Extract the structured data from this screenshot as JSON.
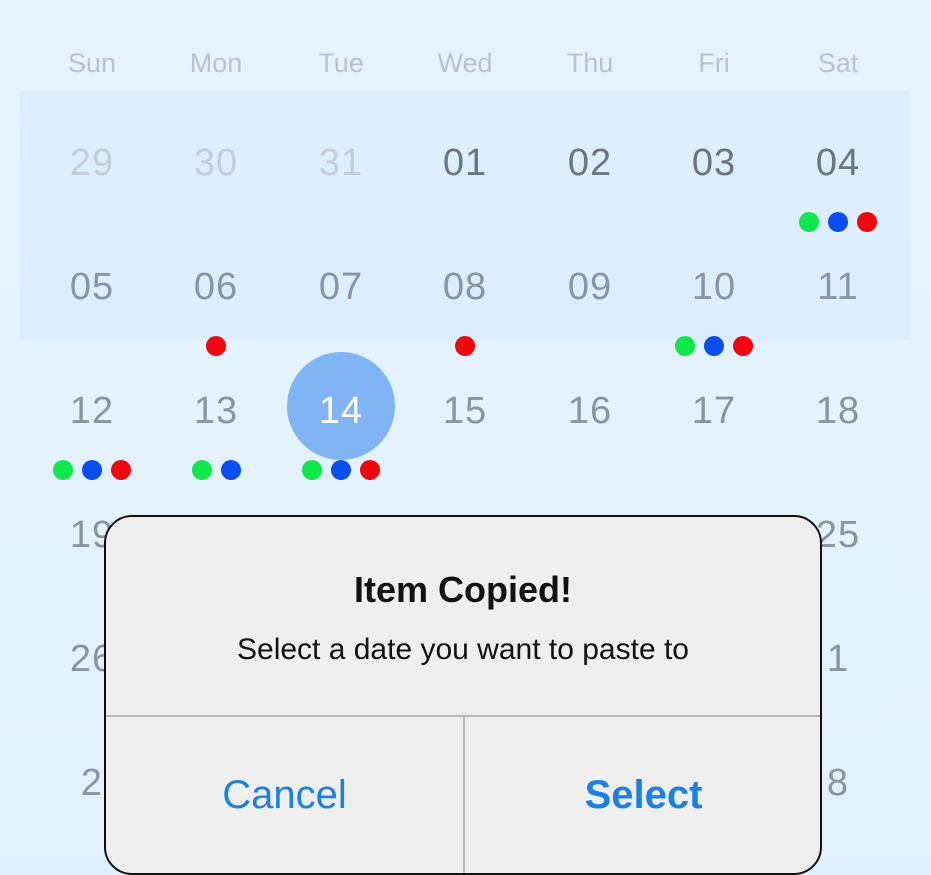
{
  "weekdays": [
    "Sun",
    "Mon",
    "Tue",
    "Wed",
    "Thu",
    "Fri",
    "Sat"
  ],
  "weeks": [
    [
      {
        "label": "29",
        "state": "muted",
        "dots": []
      },
      {
        "label": "30",
        "state": "muted",
        "dots": []
      },
      {
        "label": "31",
        "state": "muted",
        "dots": []
      },
      {
        "label": "01",
        "state": "dark",
        "dots": []
      },
      {
        "label": "02",
        "state": "dark",
        "dots": []
      },
      {
        "label": "03",
        "state": "dark",
        "dots": []
      },
      {
        "label": "04",
        "state": "dark",
        "dots": [
          "green",
          "blue",
          "red"
        ]
      }
    ],
    [
      {
        "label": "05",
        "state": "normal",
        "dots": []
      },
      {
        "label": "06",
        "state": "normal",
        "dots": [
          "red"
        ]
      },
      {
        "label": "07",
        "state": "normal",
        "dots": []
      },
      {
        "label": "08",
        "state": "normal",
        "dots": [
          "red"
        ]
      },
      {
        "label": "09",
        "state": "normal",
        "dots": []
      },
      {
        "label": "10",
        "state": "normal",
        "dots": [
          "green",
          "blue",
          "red"
        ]
      },
      {
        "label": "11",
        "state": "normal",
        "dots": []
      }
    ],
    [
      {
        "label": "12",
        "state": "normal",
        "dots": [
          "green",
          "blue",
          "red"
        ]
      },
      {
        "label": "13",
        "state": "normal",
        "dots": [
          "green",
          "blue"
        ]
      },
      {
        "label": "14",
        "state": "selected",
        "dots": [
          "green",
          "blue",
          "red"
        ]
      },
      {
        "label": "15",
        "state": "normal",
        "dots": []
      },
      {
        "label": "16",
        "state": "normal",
        "dots": []
      },
      {
        "label": "17",
        "state": "normal",
        "dots": []
      },
      {
        "label": "18",
        "state": "normal",
        "dots": []
      }
    ],
    [
      {
        "label": "19",
        "state": "normal",
        "dots": []
      },
      {
        "label": "",
        "state": "normal",
        "dots": []
      },
      {
        "label": "",
        "state": "normal",
        "dots": []
      },
      {
        "label": "",
        "state": "normal",
        "dots": []
      },
      {
        "label": "",
        "state": "normal",
        "dots": []
      },
      {
        "label": "",
        "state": "normal",
        "dots": []
      },
      {
        "label": "25",
        "state": "normal",
        "dots": []
      }
    ],
    [
      {
        "label": "26",
        "state": "normal",
        "dots": []
      },
      {
        "label": "",
        "state": "normal",
        "dots": []
      },
      {
        "label": "",
        "state": "normal",
        "dots": []
      },
      {
        "label": "",
        "state": "normal",
        "dots": []
      },
      {
        "label": "",
        "state": "normal",
        "dots": []
      },
      {
        "label": "",
        "state": "normal",
        "dots": []
      },
      {
        "label": "1",
        "state": "normal",
        "dots": []
      }
    ],
    [
      {
        "label": "2",
        "state": "normal",
        "dots": []
      },
      {
        "label": "",
        "state": "normal",
        "dots": []
      },
      {
        "label": "",
        "state": "normal",
        "dots": []
      },
      {
        "label": "",
        "state": "normal",
        "dots": []
      },
      {
        "label": "",
        "state": "normal",
        "dots": []
      },
      {
        "label": "",
        "state": "normal",
        "dots": []
      },
      {
        "label": "8",
        "state": "normal",
        "dots": []
      }
    ]
  ],
  "dot_colors": {
    "green": "#0de84a",
    "blue": "#0a4df0",
    "red": "#f0060c"
  },
  "colors": {
    "accent": "#1b7fe6",
    "selected_circle": "#80b4f4"
  },
  "dialog": {
    "title": "Item Copied!",
    "message": "Select a date you want to paste to",
    "cancel_label": "Cancel",
    "select_label": "Select"
  }
}
